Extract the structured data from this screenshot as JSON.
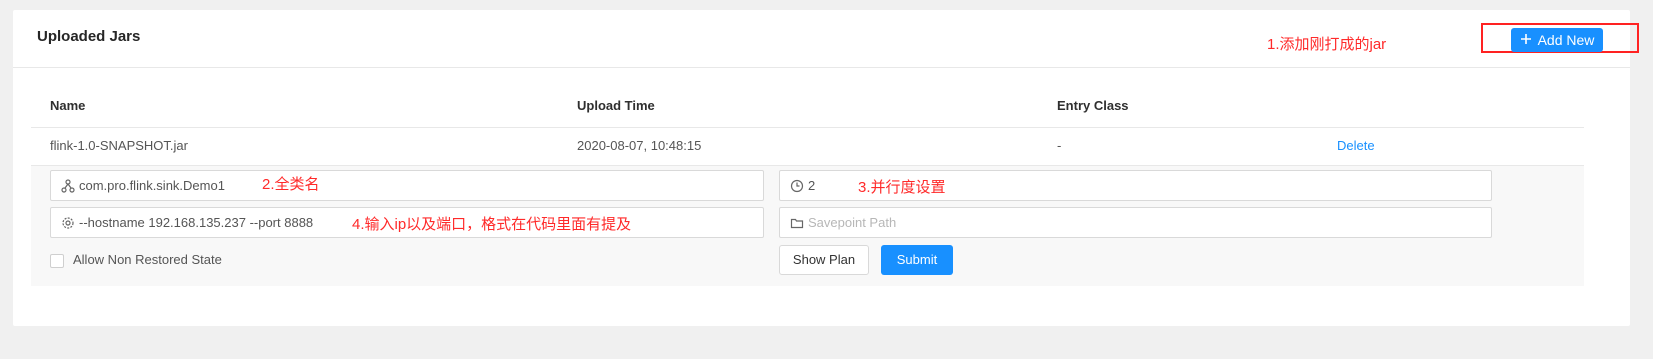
{
  "header": {
    "title": "Uploaded Jars",
    "annotation_add": "1.添加刚打成的jar",
    "add_button_label": "Add New"
  },
  "table": {
    "columns": [
      "Name",
      "Upload Time",
      "Entry Class"
    ],
    "row": {
      "name": "flink-1.0-SNAPSHOT.jar",
      "upload_time": "2020-08-07, 10:48:15",
      "entry_class": "-",
      "delete_label": "Delete"
    }
  },
  "form": {
    "entry_class_value": "com.pro.flink.sink.Demo1",
    "entry_class_note": "2.全类名",
    "parallelism_value": "2",
    "parallelism_note": "3.并行度设置",
    "program_args_value": "--hostname 192.168.135.237 --port 8888",
    "program_args_note": "4.输入ip以及端口，格式在代码里面有提及",
    "savepoint_placeholder": "Savepoint Path",
    "allow_non_restored_label": "Allow Non Restored State",
    "show_plan_label": "Show Plan",
    "submit_label": "Submit"
  },
  "icons": {
    "add": "plus-icon",
    "entry_class": "cluster-icon",
    "parallelism": "history-icon",
    "program_args": "gear-icon",
    "savepoint": "folder-icon"
  },
  "colors": {
    "accent": "#1890ff",
    "annotation": "#ff2a2a",
    "background": "#f0f0f0"
  }
}
